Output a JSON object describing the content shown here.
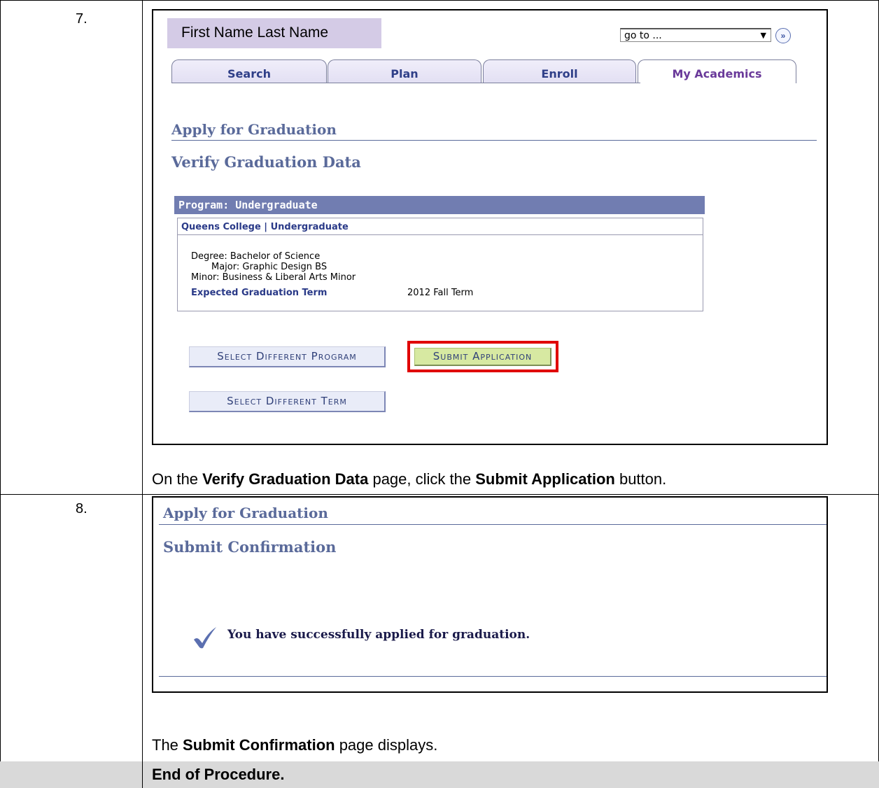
{
  "steps": [
    {
      "number": "7.",
      "screenshot": {
        "user_name": "First Name Last Name",
        "goto_value": "go to ...",
        "tabs": [
          "Search",
          "Plan",
          "Enroll",
          "My Academics"
        ],
        "active_tab": "My Academics",
        "page_title": "Apply for Graduation",
        "page_subtitle": "Verify Graduation Data",
        "program_header": "Program: Undergraduate",
        "program_sub": "Queens College | Undergraduate",
        "degree_line": "Degree: Bachelor of Science",
        "major_line": "Major: Graphic Design BS",
        "minor_line": "Minor: Business & Liberal Arts Minor",
        "expected_label": "Expected Graduation Term",
        "expected_value": "2012 Fall Term",
        "btn_select_program": "Select Different Program",
        "btn_submit": "Submit Application",
        "btn_select_term": "Select Different Term",
        "highlight_color": "#e00000"
      },
      "instruction": {
        "p1": "On the ",
        "b1": "Verify Graduation Data",
        "p2": " page, click the ",
        "b2": "Submit Application",
        "p3": " button."
      }
    },
    {
      "number": "8.",
      "screenshot": {
        "page_title": "Apply for Graduation",
        "page_subtitle": "Submit Confirmation",
        "success_icon": "checkmark-icon",
        "success_message": "You have successfully applied for graduation."
      },
      "instruction": {
        "p1": "The ",
        "b1": "Submit Confirmation",
        "p2": " page displays."
      }
    }
  ],
  "end_text": "End of Procedure.",
  "colors": {
    "name_box": "#d4cbe6",
    "heading": "#5a6a9a",
    "program_header": "#717db1",
    "submit_button": "#d7e9a2",
    "end_row": "#d9d9d9"
  }
}
